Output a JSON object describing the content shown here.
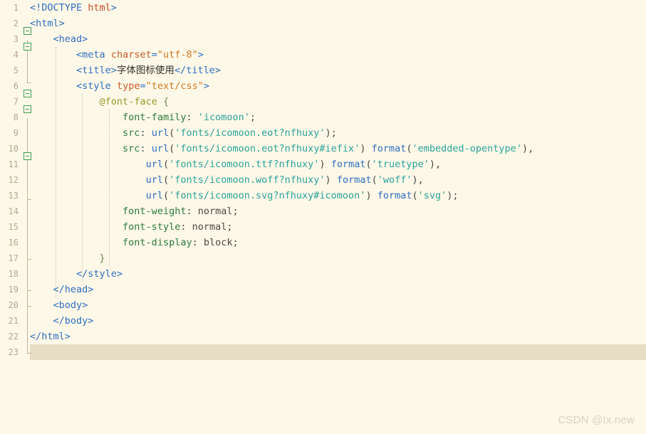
{
  "editor": {
    "background_color": "#fdf8e8",
    "highlight_color": "#e6ddc4",
    "current_line": 23,
    "line_count": 23,
    "line_height": 22
  },
  "watermark": {
    "text": "CSDN @Ix.new"
  },
  "gutter": {
    "numbers": [
      "1",
      "2",
      "3",
      "4",
      "5",
      "6",
      "7",
      "8",
      "9",
      "10",
      "11",
      "12",
      "13",
      "14",
      "15",
      "16",
      "17",
      "18",
      "19",
      "20",
      "21",
      "22",
      "23"
    ],
    "fold_markers_on_lines": [
      2,
      3,
      6,
      7,
      10
    ],
    "fold_icon": "collapse-minus-icon"
  },
  "code": {
    "language": "html",
    "lines": [
      {
        "n": 1,
        "text": "<!DOCTYPE html>"
      },
      {
        "n": 2,
        "text": "<html>"
      },
      {
        "n": 3,
        "text": "    <head>"
      },
      {
        "n": 4,
        "text": "        <meta charset=\"utf-8\">"
      },
      {
        "n": 5,
        "text": "        <title>字体图标使用</title>"
      },
      {
        "n": 6,
        "text": "        <style type=\"text/css\">"
      },
      {
        "n": 7,
        "text": "            @font-face {"
      },
      {
        "n": 8,
        "text": "                font-family: 'icomoon';"
      },
      {
        "n": 9,
        "text": "                src: url('fonts/icomoon.eot?nfhuxy');"
      },
      {
        "n": 10,
        "text": "                src: url('fonts/icomoon.eot?nfhuxy#iefix') format('embedded-opentype'),"
      },
      {
        "n": 11,
        "text": "                    url('fonts/icomoon.ttf?nfhuxy') format('truetype'),"
      },
      {
        "n": 12,
        "text": "                    url('fonts/icomoon.woff?nfhuxy') format('woff'),"
      },
      {
        "n": 13,
        "text": "                    url('fonts/icomoon.svg?nfhuxy#icomoon') format('svg');"
      },
      {
        "n": 14,
        "text": "                font-weight: normal;"
      },
      {
        "n": 15,
        "text": "                font-style: normal;"
      },
      {
        "n": 16,
        "text": "                font-display: block;"
      },
      {
        "n": 17,
        "text": "            }"
      },
      {
        "n": 18,
        "text": "        </style>"
      },
      {
        "n": 19,
        "text": "    </head>"
      },
      {
        "n": 20,
        "text": "    <body>"
      },
      {
        "n": 21,
        "text": "    </body>"
      },
      {
        "n": 22,
        "text": "</html>"
      },
      {
        "n": 23,
        "text": ""
      }
    ],
    "tokens": {
      "1": [
        [
          "t-doctype",
          "<!DOCTYPE "
        ],
        [
          "t-doctype-n",
          "html"
        ],
        [
          "t-doctype",
          ">"
        ]
      ],
      "2": [
        [
          "t-tag",
          "<html>"
        ]
      ],
      "3": [
        [
          "plain",
          "    "
        ],
        [
          "t-tag",
          "<head>"
        ]
      ],
      "4": [
        [
          "plain",
          "        "
        ],
        [
          "t-tag",
          "<meta "
        ],
        [
          "t-attr",
          "charset"
        ],
        [
          "t-punct",
          "="
        ],
        [
          "t-attrval",
          "\"utf-8\""
        ],
        [
          "t-tag",
          ">"
        ]
      ],
      "5": [
        [
          "plain",
          "        "
        ],
        [
          "t-tag",
          "<title>"
        ],
        [
          "t-text",
          "字体图标使用"
        ],
        [
          "t-tag",
          "</title>"
        ]
      ],
      "6": [
        [
          "plain",
          "        "
        ],
        [
          "t-tag",
          "<style "
        ],
        [
          "t-attr",
          "type"
        ],
        [
          "t-punct",
          "="
        ],
        [
          "t-attrval",
          "\"text/css\""
        ],
        [
          "t-tag",
          ">"
        ]
      ],
      "7": [
        [
          "plain",
          "            "
        ],
        [
          "t-atrule",
          "@font-face"
        ],
        [
          "plain",
          " "
        ],
        [
          "t-brace",
          "{"
        ]
      ],
      "8": [
        [
          "plain",
          "                "
        ],
        [
          "t-prop",
          "font-family"
        ],
        [
          "t-colon",
          ": "
        ],
        [
          "t-string",
          "'icomoon'"
        ],
        [
          "t-colon",
          ";"
        ]
      ],
      "9": [
        [
          "plain",
          "                "
        ],
        [
          "t-prop",
          "src"
        ],
        [
          "t-colon",
          ": "
        ],
        [
          "t-fn",
          "url"
        ],
        [
          "t-colon",
          "("
        ],
        [
          "t-string",
          "'fonts/icomoon.eot?nfhuxy'"
        ],
        [
          "t-colon",
          ");"
        ]
      ],
      "10": [
        [
          "plain",
          "                "
        ],
        [
          "t-prop",
          "src"
        ],
        [
          "t-colon",
          ": "
        ],
        [
          "t-fn",
          "url"
        ],
        [
          "t-colon",
          "("
        ],
        [
          "t-string",
          "'fonts/icomoon.eot?nfhuxy#iefix'"
        ],
        [
          "t-colon",
          ") "
        ],
        [
          "t-fn",
          "format"
        ],
        [
          "t-colon",
          "("
        ],
        [
          "t-string",
          "'embedded-opentype'"
        ],
        [
          "t-colon",
          "),"
        ]
      ],
      "11": [
        [
          "plain",
          "                    "
        ],
        [
          "t-fn",
          "url"
        ],
        [
          "t-colon",
          "("
        ],
        [
          "t-string",
          "'fonts/icomoon.ttf?nfhuxy'"
        ],
        [
          "t-colon",
          ") "
        ],
        [
          "t-fn",
          "format"
        ],
        [
          "t-colon",
          "("
        ],
        [
          "t-string",
          "'truetype'"
        ],
        [
          "t-colon",
          "),"
        ]
      ],
      "12": [
        [
          "plain",
          "                    "
        ],
        [
          "t-fn",
          "url"
        ],
        [
          "t-colon",
          "("
        ],
        [
          "t-string",
          "'fonts/icomoon.woff?nfhuxy'"
        ],
        [
          "t-colon",
          ") "
        ],
        [
          "t-fn",
          "format"
        ],
        [
          "t-colon",
          "("
        ],
        [
          "t-string",
          "'woff'"
        ],
        [
          "t-colon",
          "),"
        ]
      ],
      "13": [
        [
          "plain",
          "                    "
        ],
        [
          "t-fn",
          "url"
        ],
        [
          "t-colon",
          "("
        ],
        [
          "t-string",
          "'fonts/icomoon.svg?nfhuxy#icomoon'"
        ],
        [
          "t-colon",
          ") "
        ],
        [
          "t-fn",
          "format"
        ],
        [
          "t-colon",
          "("
        ],
        [
          "t-string",
          "'svg'"
        ],
        [
          "t-colon",
          ");"
        ]
      ],
      "14": [
        [
          "plain",
          "                "
        ],
        [
          "t-prop",
          "font-weight"
        ],
        [
          "t-colon",
          ": "
        ],
        [
          "t-value",
          "normal"
        ],
        [
          "t-colon",
          ";"
        ]
      ],
      "15": [
        [
          "plain",
          "                "
        ],
        [
          "t-prop",
          "font-style"
        ],
        [
          "t-colon",
          ": "
        ],
        [
          "t-value",
          "normal"
        ],
        [
          "t-colon",
          ";"
        ]
      ],
      "16": [
        [
          "plain",
          "                "
        ],
        [
          "t-prop",
          "font-display"
        ],
        [
          "t-colon",
          ": "
        ],
        [
          "t-value",
          "block"
        ],
        [
          "t-colon",
          ";"
        ]
      ],
      "17": [
        [
          "plain",
          "            "
        ],
        [
          "t-brace",
          "}"
        ]
      ],
      "18": [
        [
          "plain",
          "        "
        ],
        [
          "t-tag",
          "</style>"
        ]
      ],
      "19": [
        [
          "plain",
          "    "
        ],
        [
          "t-tag",
          "</head>"
        ]
      ],
      "20": [
        [
          "plain",
          "    "
        ],
        [
          "t-tag",
          "<body>"
        ]
      ],
      "21": [
        [
          "plain",
          "    "
        ],
        [
          "t-tag",
          "</body>"
        ]
      ],
      "22": [
        [
          "t-tag",
          "</html>"
        ]
      ],
      "23": []
    }
  },
  "colors": {
    "tag": "#2f6fc0",
    "attribute": "#c75b26",
    "attribute_value": "#d2791e",
    "doctype_name": "#cf4b23",
    "at_rule": "#97982a",
    "property": "#2c7b3c",
    "string": "#2aa29a",
    "value": "#4a4a44",
    "line_number": "#b0aa92",
    "fold_marker": "#3f9d52"
  }
}
